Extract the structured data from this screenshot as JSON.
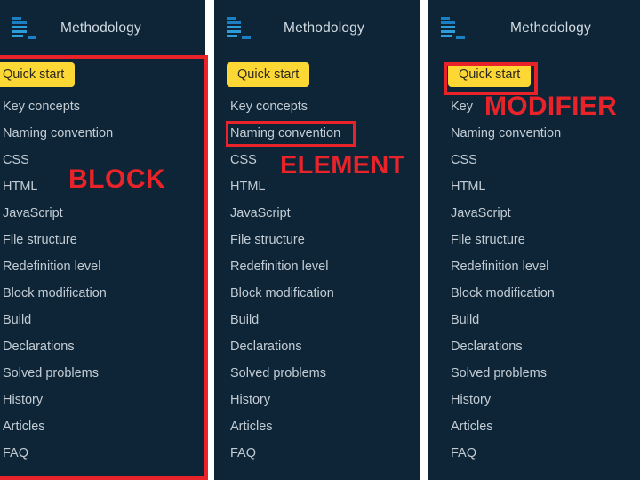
{
  "colors": {
    "panel_bg": "#0d2536",
    "accent_yellow": "#fdd835",
    "annotation_red": "#e8232a",
    "nav_text": "#c3ccd4",
    "gap_white": "#ffffff"
  },
  "nav_items": [
    "Quick start",
    "Key concepts",
    "Naming convention",
    "CSS",
    "HTML",
    "JavaScript",
    "File structure",
    "Redefinition level",
    "Block modification",
    "Build",
    "Declarations",
    "Solved problems",
    "History",
    "Articles",
    "FAQ"
  ],
  "panels": [
    {
      "id": "block",
      "title": "Methodology",
      "logo_icon": "bem-logo-icon",
      "annotation_label": "BLOCK",
      "active_item": "Quick start",
      "highlighted_target": "whole-navigation-list"
    },
    {
      "id": "element",
      "title": "Methodology",
      "logo_icon": "bem-logo-icon",
      "annotation_label": "ELEMENT",
      "active_item": "Quick start",
      "highlighted_target": "Naming convention"
    },
    {
      "id": "modifier",
      "title": "Methodology",
      "logo_icon": "bem-logo-icon",
      "annotation_label": "MODIFIER",
      "active_item": "Quick start",
      "highlighted_target": "Quick start"
    }
  ],
  "panel_modifier_truncated_item": "Key"
}
